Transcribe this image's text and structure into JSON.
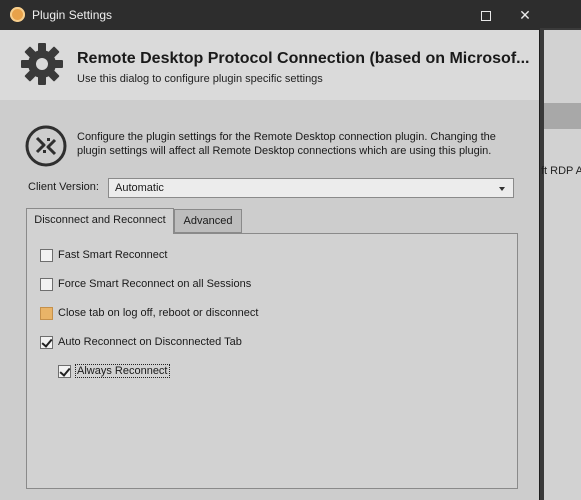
{
  "window": {
    "title": "Plugin Settings",
    "maximize_icon": "maximize-icon",
    "close_glyph": "✕"
  },
  "header": {
    "title": "Remote Desktop Protocol Connection (based on Microsof...",
    "subtitle": "Use this dialog to configure plugin specific settings",
    "icon": "gear-icon"
  },
  "info": {
    "icon": "rdp-icon",
    "text": "Configure the plugin settings for the Remote Desktop connection plugin. Changing the plugin settings will affect all Remote Desktop connections which are using this plugin."
  },
  "client_version": {
    "label": "Client Version:",
    "value": "Automatic"
  },
  "tabs": [
    {
      "label": "Disconnect and Reconnect",
      "active": true
    },
    {
      "label": "Advanced",
      "active": false
    }
  ],
  "options": [
    {
      "label": "Fast Smart Reconnect",
      "checked": false
    },
    {
      "label": "Force Smart Reconnect on all Sessions",
      "checked": false
    },
    {
      "label": "Close tab on log off, reboot or disconnect",
      "checked": false,
      "highlighted": true
    },
    {
      "label": "Auto Reconnect on Disconnected Tab",
      "checked": true
    },
    {
      "label": "Always Reconnect",
      "checked": true,
      "focused": true
    }
  ],
  "background_app": {
    "partial_text": "ft RDP A"
  },
  "colors": {
    "titlebar": "#2d2d2d",
    "dialog_bg": "#cdcdcd",
    "header_bg": "#dadada",
    "highlight": "#e9b468"
  }
}
